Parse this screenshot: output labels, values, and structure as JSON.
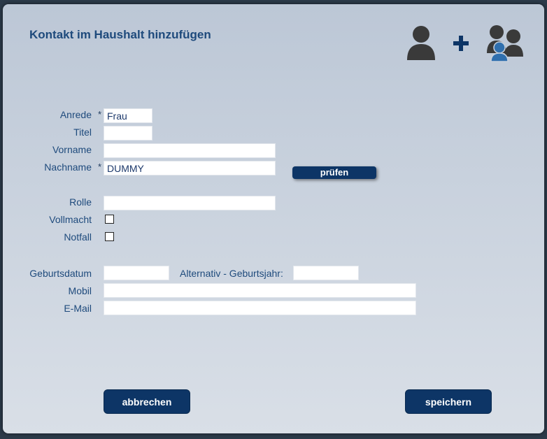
{
  "dialog": {
    "title": "Kontakt im Haushalt hinzufügen",
    "icons": [
      "person-icon",
      "plus-icon",
      "group-icon"
    ],
    "accent_color": "#1e4a7c",
    "button_color": "#0d3566"
  },
  "form": {
    "required_marker": "*",
    "anrede": {
      "label": "Anrede",
      "value": "Frau"
    },
    "titel": {
      "label": "Titel",
      "value": ""
    },
    "vorname": {
      "label": "Vorname",
      "value": ""
    },
    "nachname": {
      "label": "Nachname",
      "value": "DUMMY"
    },
    "pruefen_label": "prüfen",
    "rolle": {
      "label": "Rolle",
      "value": ""
    },
    "vollmacht": {
      "label": "Vollmacht",
      "checked": false
    },
    "notfall": {
      "label": "Notfall",
      "checked": false
    },
    "geburtsdatum": {
      "label": "Geburtsdatum",
      "value": ""
    },
    "geburtsjahr": {
      "label": "Alternativ - Geburtsjahr:",
      "value": ""
    },
    "mobil": {
      "label": "Mobil",
      "value": ""
    },
    "email": {
      "label": "E-Mail",
      "value": ""
    }
  },
  "actions": {
    "cancel_label": "abbrechen",
    "save_label": "speichern"
  }
}
